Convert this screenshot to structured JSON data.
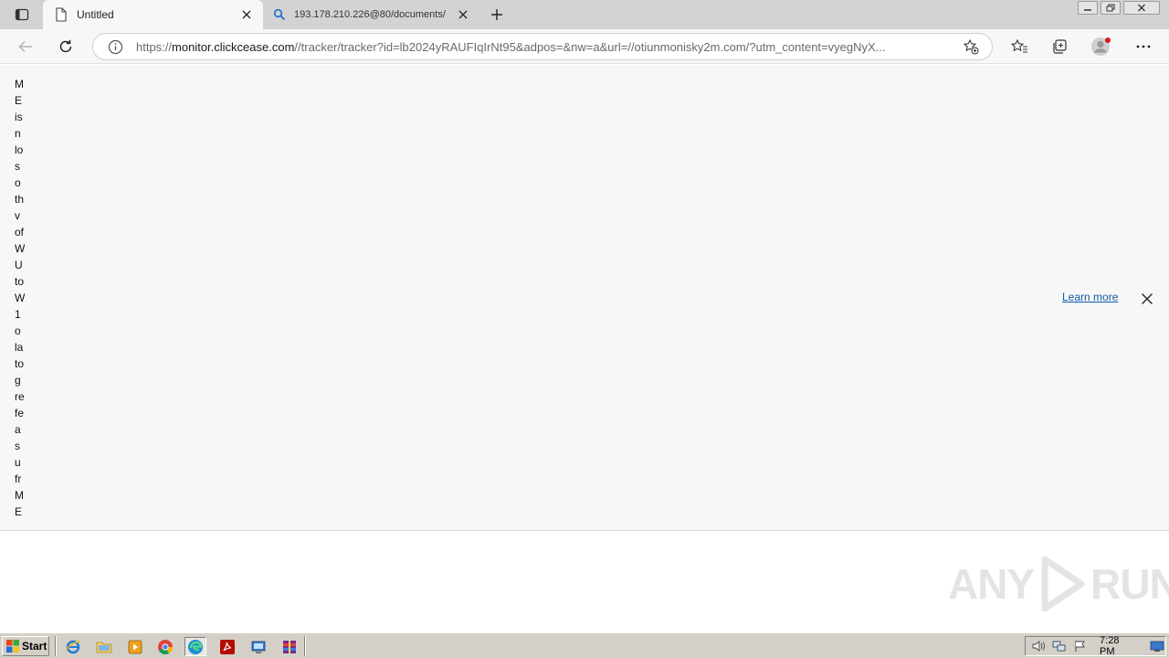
{
  "browser": {
    "tabs": [
      {
        "title": "Untitled",
        "active": true
      },
      {
        "title": "193.178.210.226@80/documents/",
        "active": false
      }
    ],
    "address": {
      "scheme_prefix": "https://",
      "host": "monitor.clickcease.com",
      "path": "//tracker/tracker?id=lb2024yRAUFIqIrNt95&adpos=&nw=a&url=//otiunmonisky2m.com/?utm_content=vyegNyX..."
    }
  },
  "page": {
    "column_words": [
      "M",
      "E",
      "is",
      "n",
      "lo",
      "s",
      "o",
      "th",
      "v",
      "of",
      "W",
      "U",
      "to",
      "W",
      "1",
      "o",
      "la",
      "to",
      "g",
      "re",
      "fe",
      "a",
      "s",
      "u",
      "fr",
      "M",
      "E"
    ],
    "banner": {
      "learn_more": "Learn more"
    }
  },
  "watermark": {
    "left": "ANY",
    "right": "RUN"
  },
  "taskbar": {
    "start_label": "Start",
    "clock": "7:28 PM"
  },
  "colors": {
    "link": "#0f5aa8",
    "tab_strip": "#d3d3d3",
    "page_bg": "#f7f7f7",
    "taskbar": "#d4d0c8"
  }
}
